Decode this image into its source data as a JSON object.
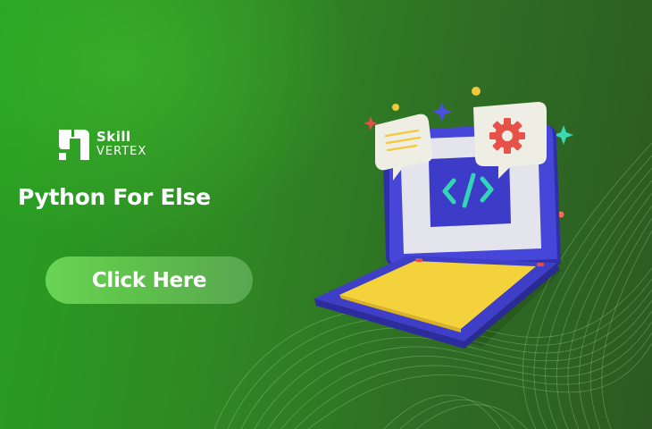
{
  "brand": {
    "logo_line1": "Skill",
    "logo_line2": "VERTEX"
  },
  "headline": {
    "title": "Python For Else"
  },
  "cta": {
    "label": "Click Here"
  },
  "illustration": {
    "screen_icon": "code-brackets-icon",
    "bubble_left_icon": "document-lines-icon",
    "bubble_right_icon": "gear-icon"
  },
  "colors": {
    "background_start": "#27a022",
    "background_end": "#2c5a22",
    "button": "#62c94d",
    "laptop_body": "#3f3fd0",
    "keyboard": "#f4d23c",
    "screen_code": "#33d6b4",
    "gear": "#e8504a"
  }
}
